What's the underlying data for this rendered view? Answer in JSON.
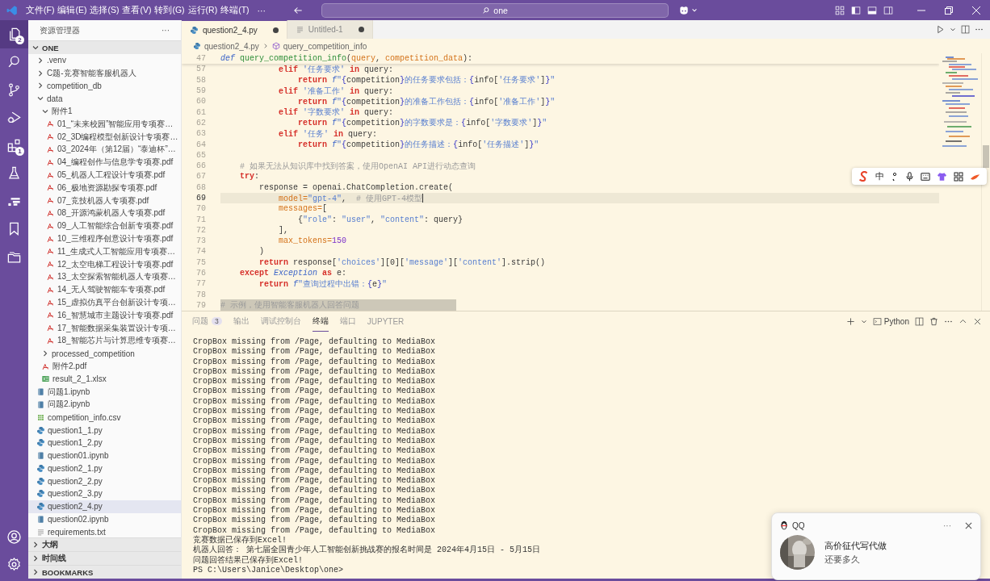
{
  "title_bar": {
    "menus": [
      "文件(F)",
      "编辑(E)",
      "选择(S)",
      "查看(V)",
      "转到(G)",
      "运行(R)",
      "终端(T)"
    ],
    "more": "···",
    "search": "one"
  },
  "activity_bar": {
    "items": [
      {
        "kind": "explorer",
        "badge": "2",
        "selected": true
      },
      {
        "kind": "search",
        "selected": false
      },
      {
        "kind": "source-control",
        "selected": false
      },
      {
        "kind": "run-debug",
        "selected": false
      },
      {
        "kind": "extensions",
        "badge": "1",
        "selected": false
      },
      {
        "kind": "testing",
        "selected": false
      },
      {
        "kind": "remote",
        "selected": false
      },
      {
        "kind": "bookmarks",
        "selected": false
      },
      {
        "kind": "folders",
        "selected": false
      }
    ],
    "bottom": [
      {
        "kind": "account"
      },
      {
        "kind": "settings"
      }
    ]
  },
  "explorer": {
    "title": "资源管理器",
    "more": "···",
    "root": {
      "label": "ONE",
      "expanded": true,
      "children": [
        {
          "kind": "folder",
          "label": ".venv",
          "expanded": false,
          "selected": false
        },
        {
          "kind": "folder",
          "label": "C题-竞赛智能客服机器人",
          "expanded": false,
          "selected": false
        },
        {
          "kind": "folder",
          "label": "competition_db",
          "expanded": false,
          "selected": false
        },
        {
          "kind": "folder",
          "label": "data",
          "expanded": true,
          "selected": false,
          "children": [
            {
              "kind": "folder",
              "label": "附件1",
              "expanded": true,
              "selected": false,
              "children": [
                {
                  "kind": "pdf",
                  "label": "01_“未来校园”智能应用专项赛…",
                  "selected": false
                },
                {
                  "kind": "pdf",
                  "label": "02_3D编程模型创新设计专项赛…",
                  "selected": false
                },
                {
                  "kind": "pdf",
                  "label": "03_2024年（第12届）“泰迪杯”…",
                  "selected": false
                },
                {
                  "kind": "pdf",
                  "label": "04_编程创作与信息学专项赛.pdf",
                  "selected": false
                },
                {
                  "kind": "pdf",
                  "label": "05_机器人工程设计专项赛.pdf",
                  "selected": false
                },
                {
                  "kind": "pdf",
                  "label": "06_极地资源勘探专项赛.pdf",
                  "selected": false
                },
                {
                  "kind": "pdf",
                  "label": "07_竞技机器人专项赛.pdf",
                  "selected": false
                },
                {
                  "kind": "pdf",
                  "label": "08_开源鸿蒙机器人专项赛.pdf",
                  "selected": false
                },
                {
                  "kind": "pdf",
                  "label": "09_人工智能综合创新专项赛.pdf",
                  "selected": false
                },
                {
                  "kind": "pdf",
                  "label": "10_三维程序创意设计专项赛.pdf",
                  "selected": false
                },
                {
                  "kind": "pdf",
                  "label": "11_生成式人工智能应用专项赛…",
                  "selected": false
                },
                {
                  "kind": "pdf",
                  "label": "12_太空电梯工程设计专项赛.pdf",
                  "selected": false
                },
                {
                  "kind": "pdf",
                  "label": "13_太空探索智能机器人专项赛…",
                  "selected": false
                },
                {
                  "kind": "pdf",
                  "label": "14_无人驾驶智能车专项赛.pdf",
                  "selected": false
                },
                {
                  "kind": "pdf",
                  "label": "15_虚拟仿真平台创新设计专项…",
                  "selected": false
                },
                {
                  "kind": "pdf",
                  "label": "16_智慧城市主题设计专项赛.pdf",
                  "selected": false
                },
                {
                  "kind": "pdf",
                  "label": "17_智能数据采集装置设计专项…",
                  "selected": false
                },
                {
                  "kind": "pdf",
                  "label": "18_智能芯片与计算思维专项赛…",
                  "selected": false
                }
              ]
            },
            {
              "kind": "folder",
              "label": "processed_competition",
              "expanded": false,
              "selected": false
            },
            {
              "kind": "pdf",
              "label": "附件2.pdf",
              "selected": false
            },
            {
              "kind": "excel",
              "label": "result_2_1.xlsx",
              "selected": false
            }
          ]
        },
        {
          "kind": "notebook",
          "label": "问题1.ipynb",
          "selected": false
        },
        {
          "kind": "notebook",
          "label": "问题2.ipynb",
          "selected": false
        },
        {
          "kind": "csv",
          "label": "competition_info.csv",
          "selected": false
        },
        {
          "kind": "python",
          "label": "question1_1.py",
          "selected": false
        },
        {
          "kind": "python",
          "label": "question1_2.py",
          "selected": false
        },
        {
          "kind": "notebook",
          "label": "question01.ipynb",
          "selected": false
        },
        {
          "kind": "python",
          "label": "question2_1.py",
          "selected": false
        },
        {
          "kind": "python",
          "label": "question2_2.py",
          "selected": false
        },
        {
          "kind": "python",
          "label": "question2_3.py",
          "selected": false
        },
        {
          "kind": "python",
          "label": "question2_4.py",
          "selected": true
        },
        {
          "kind": "notebook",
          "label": "question02.ipynb",
          "selected": false
        },
        {
          "kind": "text",
          "label": "requirements.txt",
          "selected": false
        }
      ]
    },
    "sections": [
      {
        "label": "大纲",
        "expanded": false
      },
      {
        "label": "时间线",
        "expanded": false
      },
      {
        "label": "BOOKMARKS",
        "expanded": false
      }
    ]
  },
  "editor": {
    "tabs": [
      {
        "label": "question2_4.py",
        "kind": "python",
        "selected": true,
        "modified": true
      },
      {
        "label": "Untitled-1",
        "kind": "text",
        "selected": false,
        "modified": true
      }
    ],
    "breadcrumb": [
      "question2_4.py",
      "query_competition_info"
    ],
    "sticky_line": {
      "number": "47",
      "tokens": [
        {
          "kind": "kw",
          "text": "def "
        },
        {
          "kind": "fn",
          "text": "query_competition_info"
        },
        {
          "kind": "plain",
          "text": "("
        },
        {
          "kind": "param",
          "text": "query"
        },
        {
          "kind": "plain",
          "text": ", "
        },
        {
          "kind": "param",
          "text": "competition_data"
        },
        {
          "kind": "plain",
          "text": "):"
        }
      ]
    },
    "lines": [
      {
        "number": "57",
        "tokens": [
          {
            "kind": "ctrl",
            "text": "            elif "
          },
          {
            "kind": "str",
            "text": "'任务要求'"
          },
          {
            "kind": "ctrl",
            "text": " in "
          },
          {
            "kind": "plain",
            "text": "query:"
          }
        ]
      },
      {
        "number": "58",
        "tokens": [
          {
            "kind": "ctrl",
            "text": "                return "
          },
          {
            "kind": "fk",
            "text": "f"
          },
          {
            "kind": "str",
            "text": "\""
          },
          {
            "kind": "br",
            "text": "{"
          },
          {
            "kind": "plain",
            "text": "competition"
          },
          {
            "kind": "br",
            "text": "}"
          },
          {
            "kind": "str",
            "text": "的任务要求包括："
          },
          {
            "kind": "br",
            "text": "{"
          },
          {
            "kind": "plain",
            "text": "info["
          },
          {
            "kind": "str",
            "text": "'任务要求'"
          },
          {
            "kind": "plain",
            "text": "]"
          },
          {
            "kind": "br",
            "text": "}"
          },
          {
            "kind": "str",
            "text": "\""
          }
        ]
      },
      {
        "number": "59",
        "tokens": [
          {
            "kind": "ctrl",
            "text": "            elif "
          },
          {
            "kind": "str",
            "text": "'准备工作'"
          },
          {
            "kind": "ctrl",
            "text": " in "
          },
          {
            "kind": "plain",
            "text": "query:"
          }
        ]
      },
      {
        "number": "60",
        "tokens": [
          {
            "kind": "ctrl",
            "text": "                return "
          },
          {
            "kind": "fk",
            "text": "f"
          },
          {
            "kind": "str",
            "text": "\""
          },
          {
            "kind": "br",
            "text": "{"
          },
          {
            "kind": "plain",
            "text": "competition"
          },
          {
            "kind": "br",
            "text": "}"
          },
          {
            "kind": "str",
            "text": "的准备工作包括："
          },
          {
            "kind": "br",
            "text": "{"
          },
          {
            "kind": "plain",
            "text": "info["
          },
          {
            "kind": "str",
            "text": "'准备工作'"
          },
          {
            "kind": "plain",
            "text": "]"
          },
          {
            "kind": "br",
            "text": "}"
          },
          {
            "kind": "str",
            "text": "\""
          }
        ]
      },
      {
        "number": "61",
        "tokens": [
          {
            "kind": "ctrl",
            "text": "            elif "
          },
          {
            "kind": "str",
            "text": "'字数要求'"
          },
          {
            "kind": "ctrl",
            "text": " in "
          },
          {
            "kind": "plain",
            "text": "query:"
          }
        ]
      },
      {
        "number": "62",
        "tokens": [
          {
            "kind": "ctrl",
            "text": "                return "
          },
          {
            "kind": "fk",
            "text": "f"
          },
          {
            "kind": "str",
            "text": "\""
          },
          {
            "kind": "br",
            "text": "{"
          },
          {
            "kind": "plain",
            "text": "competition"
          },
          {
            "kind": "br",
            "text": "}"
          },
          {
            "kind": "str",
            "text": "的字数要求是："
          },
          {
            "kind": "br",
            "text": "{"
          },
          {
            "kind": "plain",
            "text": "info["
          },
          {
            "kind": "str",
            "text": "'字数要求'"
          },
          {
            "kind": "plain",
            "text": "]"
          },
          {
            "kind": "br",
            "text": "}"
          },
          {
            "kind": "str",
            "text": "\""
          }
        ]
      },
      {
        "number": "63",
        "tokens": [
          {
            "kind": "ctrl",
            "text": "            elif "
          },
          {
            "kind": "str",
            "text": "'任务'"
          },
          {
            "kind": "ctrl",
            "text": " in "
          },
          {
            "kind": "plain",
            "text": "query:"
          }
        ]
      },
      {
        "number": "64",
        "tokens": [
          {
            "kind": "ctrl",
            "text": "                return "
          },
          {
            "kind": "fk",
            "text": "f"
          },
          {
            "kind": "str",
            "text": "\""
          },
          {
            "kind": "br",
            "text": "{"
          },
          {
            "kind": "plain",
            "text": "competition"
          },
          {
            "kind": "br",
            "text": "}"
          },
          {
            "kind": "str",
            "text": "的任务描述："
          },
          {
            "kind": "br",
            "text": "{"
          },
          {
            "kind": "plain",
            "text": "info["
          },
          {
            "kind": "str",
            "text": "'任务描述'"
          },
          {
            "kind": "plain",
            "text": "]"
          },
          {
            "kind": "br",
            "text": "}"
          },
          {
            "kind": "str",
            "text": "\""
          }
        ]
      },
      {
        "number": "65"
      },
      {
        "number": "66",
        "tokens": [
          {
            "kind": "cm",
            "text": "    # 如果无法从知识库中找到答案，使用OpenAI API进行动态查询"
          }
        ]
      },
      {
        "number": "67",
        "tokens": [
          {
            "kind": "ctrl",
            "text": "    try"
          },
          {
            "kind": "plain",
            "text": ":"
          }
        ]
      },
      {
        "number": "68",
        "tokens": [
          {
            "kind": "plain",
            "text": "        response = openai.ChatCompletion.create("
          }
        ]
      },
      {
        "number": "69",
        "kind": "current",
        "tokens": [
          {
            "kind": "kwarg",
            "text": "            model="
          },
          {
            "kind": "str",
            "text": "\"gpt-4\""
          },
          {
            "kind": "plain",
            "text": ",  "
          },
          {
            "kind": "cm",
            "text": "# 使用GPT-4模型"
          }
        ]
      },
      {
        "number": "70",
        "tokens": [
          {
            "kind": "kwarg",
            "text": "            messages="
          },
          {
            "kind": "plain",
            "text": "["
          }
        ]
      },
      {
        "number": "71",
        "tokens": [
          {
            "kind": "plain",
            "text": "                {"
          },
          {
            "kind": "str",
            "text": "\"role\""
          },
          {
            "kind": "plain",
            "text": ": "
          },
          {
            "kind": "str",
            "text": "\"user\""
          },
          {
            "kind": "plain",
            "text": ", "
          },
          {
            "kind": "str",
            "text": "\"content\""
          },
          {
            "kind": "plain",
            "text": ": query}"
          }
        ]
      },
      {
        "number": "72",
        "tokens": [
          {
            "kind": "plain",
            "text": "            ],"
          }
        ]
      },
      {
        "number": "73",
        "tokens": [
          {
            "kind": "kwarg",
            "text": "            max_tokens="
          },
          {
            "kind": "num",
            "text": "150"
          }
        ]
      },
      {
        "number": "74",
        "tokens": [
          {
            "kind": "plain",
            "text": "        )"
          }
        ]
      },
      {
        "number": "75",
        "tokens": [
          {
            "kind": "ctrl",
            "text": "        return "
          },
          {
            "kind": "plain",
            "text": "response["
          },
          {
            "kind": "str",
            "text": "'choices'"
          },
          {
            "kind": "plain",
            "text": "][0]["
          },
          {
            "kind": "str",
            "text": "'message'"
          },
          {
            "kind": "plain",
            "text": "]["
          },
          {
            "kind": "str",
            "text": "'content'"
          },
          {
            "kind": "plain",
            "text": "].strip()"
          }
        ]
      },
      {
        "number": "76",
        "tokens": [
          {
            "kind": "ctrl",
            "text": "    except "
          },
          {
            "kind": "cls",
            "text": "Exception"
          },
          {
            "kind": "ctrl",
            "text": " as "
          },
          {
            "kind": "plain",
            "text": "e:"
          }
        ]
      },
      {
        "number": "77",
        "tokens": [
          {
            "kind": "ctrl",
            "text": "        return "
          },
          {
            "kind": "fk",
            "text": "f"
          },
          {
            "kind": "str",
            "text": "\"查询过程中出错："
          },
          {
            "kind": "br",
            "text": "{"
          },
          {
            "kind": "plain",
            "text": "e"
          },
          {
            "kind": "br",
            "text": "}"
          },
          {
            "kind": "str",
            "text": "\""
          }
        ]
      },
      {
        "number": "78"
      },
      {
        "number": "79",
        "kind": "selection",
        "tokens": [
          {
            "kind": "cm",
            "text": "# 示例，使用智能客服机器人回答问题"
          }
        ]
      }
    ]
  },
  "ime_toolbar": {
    "mode": "中"
  },
  "panel": {
    "tabs": [
      {
        "label": "问题",
        "badge": "3",
        "selected": false
      },
      {
        "label": "输出",
        "selected": false
      },
      {
        "label": "调试控制台",
        "selected": false
      },
      {
        "label": "终端",
        "selected": true
      },
      {
        "label": "端口",
        "selected": false
      },
      {
        "label": "JUPYTER",
        "selected": false
      }
    ],
    "terminal_profile": "Python",
    "terminal_lines": [
      "CropBox missing from /Page, defaulting to MediaBox",
      "CropBox missing from /Page, defaulting to MediaBox",
      "CropBox missing from /Page, defaulting to MediaBox",
      "CropBox missing from /Page, defaulting to MediaBox",
      "CropBox missing from /Page, defaulting to MediaBox",
      "CropBox missing from /Page, defaulting to MediaBox",
      "CropBox missing from /Page, defaulting to MediaBox",
      "CropBox missing from /Page, defaulting to MediaBox",
      "CropBox missing from /Page, defaulting to MediaBox",
      "CropBox missing from /Page, defaulting to MediaBox",
      "CropBox missing from /Page, defaulting to MediaBox",
      "CropBox missing from /Page, defaulting to MediaBox",
      "CropBox missing from /Page, defaulting to MediaBox",
      "CropBox missing from /Page, defaulting to MediaBox",
      "CropBox missing from /Page, defaulting to MediaBox",
      "CropBox missing from /Page, defaulting to MediaBox",
      "CropBox missing from /Page, defaulting to MediaBox",
      "CropBox missing from /Page, defaulting to MediaBox",
      "CropBox missing from /Page, defaulting to MediaBox",
      "CropBox missing from /Page, defaulting to MediaBox",
      "竞赛数据已保存到Excel!",
      "机器人回答： 第七届全国青少年人工智能创新挑战赛的报名时间是 2024年4月15日 - 5月15日",
      "问题回答结果已保存到Excel!",
      "PS C:\\Users\\Janice\\Desktop\\one>"
    ]
  },
  "notification": {
    "app": "QQ",
    "more": "···",
    "title": "高价征代写代做",
    "message": "还要多久"
  }
}
